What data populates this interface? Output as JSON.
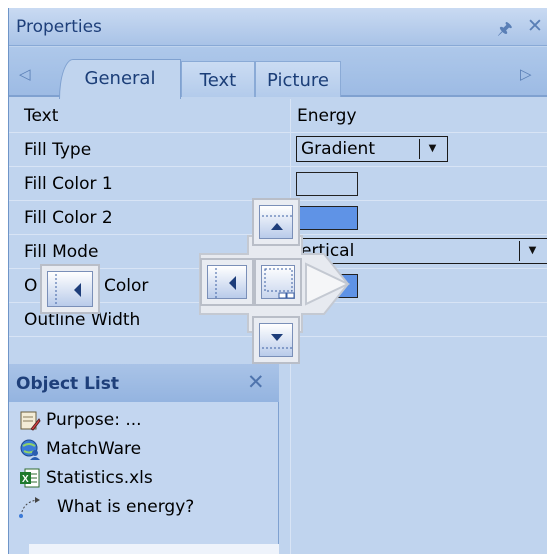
{
  "panel": {
    "title": "Properties",
    "pin_icon": "pin-icon",
    "close_icon": "close-icon"
  },
  "tabs": {
    "items": [
      {
        "label": "General",
        "active": true
      },
      {
        "label": "Text",
        "active": false
      },
      {
        "label": "Picture",
        "active": false
      }
    ],
    "scroll_left_icon": "triangle-left-icon",
    "scroll_right_icon": "triangle-right-icon"
  },
  "properties": [
    {
      "name": "Text",
      "value": "Energy"
    },
    {
      "name": "Fill Type",
      "value": "Gradient"
    },
    {
      "name": "Fill Color 1",
      "value": ""
    },
    {
      "name": "Fill Color 2",
      "value": ""
    },
    {
      "name": "Fill Mode",
      "value": "ertical"
    },
    {
      "name": "O",
      "name_suffix": "Color",
      "value": ""
    },
    {
      "name": "Outline Width",
      "value": ""
    }
  ],
  "object_list": {
    "title": "Object List",
    "items": [
      {
        "label": "Purpose: ...",
        "icon": "notepad-icon"
      },
      {
        "label": "MatchWare",
        "icon": "globe-user-icon"
      },
      {
        "label": "Statistics.xls",
        "icon": "excel-icon"
      },
      {
        "label": "What is energy?",
        "icon": "path-arrow-icon"
      }
    ]
  },
  "colors": {
    "panel_bg": "#c0d4ee",
    "title_text": "#1e3f7a",
    "fill_color_1": "#c0d4ee",
    "fill_color_2": "#5f93e6",
    "outline_color": "#5f93e6"
  },
  "dock_guide": {
    "icons": [
      "dock-top-icon",
      "dock-left-icon",
      "dock-center-icon",
      "dock-bottom-icon",
      "dock-right-arrow-icon",
      "dock-far-left-icon"
    ]
  }
}
